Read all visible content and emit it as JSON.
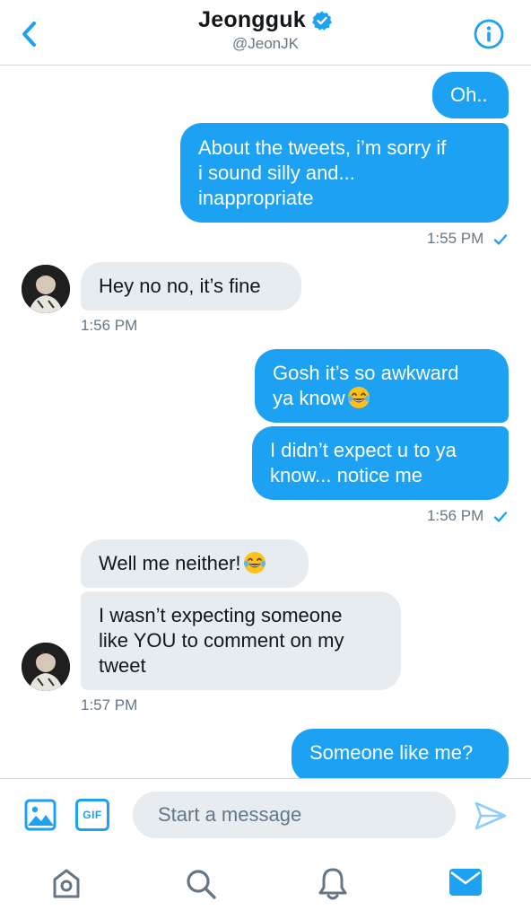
{
  "header": {
    "name": "Jeongguk",
    "handle": "@JeonJK"
  },
  "messages": [
    {
      "type": "sent",
      "text": "Oh.."
    },
    {
      "type": "sent",
      "lines": [
        "About the tweets, i’m sorry if",
        "i sound silly and...",
        "inappropriate"
      ]
    },
    {
      "type": "sent_time",
      "time": "1:55 PM"
    },
    {
      "type": "received",
      "text": "Hey no no, it’s fine"
    },
    {
      "type": "received_time",
      "time": "1:56 PM"
    },
    {
      "type": "sent",
      "lines": [
        "Gosh it’s so awkward",
        "ya know"
      ],
      "emoji": "face-with-tears-of-joy"
    },
    {
      "type": "sent",
      "lines": [
        "I didn’t expect u to ya",
        "know... notice me"
      ]
    },
    {
      "type": "sent_time",
      "time": "1:56 PM"
    },
    {
      "type": "received",
      "text": "Well me neither!",
      "emoji": "face-with-tears-of-joy"
    },
    {
      "type": "received",
      "lines": [
        "I wasn’t expecting someone",
        "like YOU to comment on my",
        "tweet"
      ]
    },
    {
      "type": "received_time",
      "time": "1:57 PM"
    },
    {
      "type": "sent",
      "text": "Someone like me?"
    }
  ],
  "composer": {
    "placeholder": "Start a message",
    "gif_label": "GIF"
  },
  "colors": {
    "accent": "#1da1f2",
    "received_bubble": "#e6ecf0",
    "secondary_text": "#657786"
  },
  "icons": [
    "back-chevron-icon",
    "verified-badge-icon",
    "info-icon",
    "image-icon",
    "gif-icon",
    "send-icon",
    "home-icon",
    "search-icon",
    "notifications-bell-icon",
    "messages-envelope-icon"
  ]
}
